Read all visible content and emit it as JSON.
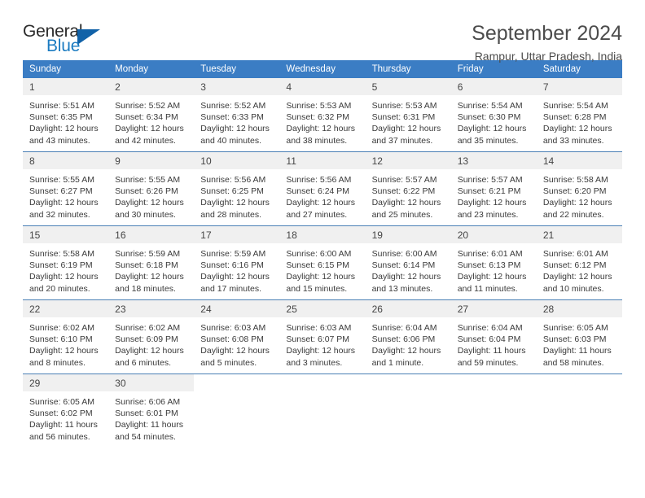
{
  "logo": {
    "word_top": "General",
    "word_bottom": "Blue",
    "triangle": "blue-triangle-icon"
  },
  "header": {
    "month_title": "September 2024",
    "location": "Rampur, Uttar Pradesh, India"
  },
  "colors": {
    "header_blue": "#3b7dc4",
    "logo_blue": "#1b7bc1",
    "daynum_bg": "#f0f0f0",
    "row_divider": "#4a7fb5"
  },
  "weekday_headers": [
    "Sunday",
    "Monday",
    "Tuesday",
    "Wednesday",
    "Thursday",
    "Friday",
    "Saturday"
  ],
  "weeks": [
    [
      {
        "day": "1",
        "sunrise": "Sunrise: 5:51 AM",
        "sunset": "Sunset: 6:35 PM",
        "daylight1": "Daylight: 12 hours",
        "daylight2": "and 43 minutes."
      },
      {
        "day": "2",
        "sunrise": "Sunrise: 5:52 AM",
        "sunset": "Sunset: 6:34 PM",
        "daylight1": "Daylight: 12 hours",
        "daylight2": "and 42 minutes."
      },
      {
        "day": "3",
        "sunrise": "Sunrise: 5:52 AM",
        "sunset": "Sunset: 6:33 PM",
        "daylight1": "Daylight: 12 hours",
        "daylight2": "and 40 minutes."
      },
      {
        "day": "4",
        "sunrise": "Sunrise: 5:53 AM",
        "sunset": "Sunset: 6:32 PM",
        "daylight1": "Daylight: 12 hours",
        "daylight2": "and 38 minutes."
      },
      {
        "day": "5",
        "sunrise": "Sunrise: 5:53 AM",
        "sunset": "Sunset: 6:31 PM",
        "daylight1": "Daylight: 12 hours",
        "daylight2": "and 37 minutes."
      },
      {
        "day": "6",
        "sunrise": "Sunrise: 5:54 AM",
        "sunset": "Sunset: 6:30 PM",
        "daylight1": "Daylight: 12 hours",
        "daylight2": "and 35 minutes."
      },
      {
        "day": "7",
        "sunrise": "Sunrise: 5:54 AM",
        "sunset": "Sunset: 6:28 PM",
        "daylight1": "Daylight: 12 hours",
        "daylight2": "and 33 minutes."
      }
    ],
    [
      {
        "day": "8",
        "sunrise": "Sunrise: 5:55 AM",
        "sunset": "Sunset: 6:27 PM",
        "daylight1": "Daylight: 12 hours",
        "daylight2": "and 32 minutes."
      },
      {
        "day": "9",
        "sunrise": "Sunrise: 5:55 AM",
        "sunset": "Sunset: 6:26 PM",
        "daylight1": "Daylight: 12 hours",
        "daylight2": "and 30 minutes."
      },
      {
        "day": "10",
        "sunrise": "Sunrise: 5:56 AM",
        "sunset": "Sunset: 6:25 PM",
        "daylight1": "Daylight: 12 hours",
        "daylight2": "and 28 minutes."
      },
      {
        "day": "11",
        "sunrise": "Sunrise: 5:56 AM",
        "sunset": "Sunset: 6:24 PM",
        "daylight1": "Daylight: 12 hours",
        "daylight2": "and 27 minutes."
      },
      {
        "day": "12",
        "sunrise": "Sunrise: 5:57 AM",
        "sunset": "Sunset: 6:22 PM",
        "daylight1": "Daylight: 12 hours",
        "daylight2": "and 25 minutes."
      },
      {
        "day": "13",
        "sunrise": "Sunrise: 5:57 AM",
        "sunset": "Sunset: 6:21 PM",
        "daylight1": "Daylight: 12 hours",
        "daylight2": "and 23 minutes."
      },
      {
        "day": "14",
        "sunrise": "Sunrise: 5:58 AM",
        "sunset": "Sunset: 6:20 PM",
        "daylight1": "Daylight: 12 hours",
        "daylight2": "and 22 minutes."
      }
    ],
    [
      {
        "day": "15",
        "sunrise": "Sunrise: 5:58 AM",
        "sunset": "Sunset: 6:19 PM",
        "daylight1": "Daylight: 12 hours",
        "daylight2": "and 20 minutes."
      },
      {
        "day": "16",
        "sunrise": "Sunrise: 5:59 AM",
        "sunset": "Sunset: 6:18 PM",
        "daylight1": "Daylight: 12 hours",
        "daylight2": "and 18 minutes."
      },
      {
        "day": "17",
        "sunrise": "Sunrise: 5:59 AM",
        "sunset": "Sunset: 6:16 PM",
        "daylight1": "Daylight: 12 hours",
        "daylight2": "and 17 minutes."
      },
      {
        "day": "18",
        "sunrise": "Sunrise: 6:00 AM",
        "sunset": "Sunset: 6:15 PM",
        "daylight1": "Daylight: 12 hours",
        "daylight2": "and 15 minutes."
      },
      {
        "day": "19",
        "sunrise": "Sunrise: 6:00 AM",
        "sunset": "Sunset: 6:14 PM",
        "daylight1": "Daylight: 12 hours",
        "daylight2": "and 13 minutes."
      },
      {
        "day": "20",
        "sunrise": "Sunrise: 6:01 AM",
        "sunset": "Sunset: 6:13 PM",
        "daylight1": "Daylight: 12 hours",
        "daylight2": "and 11 minutes."
      },
      {
        "day": "21",
        "sunrise": "Sunrise: 6:01 AM",
        "sunset": "Sunset: 6:12 PM",
        "daylight1": "Daylight: 12 hours",
        "daylight2": "and 10 minutes."
      }
    ],
    [
      {
        "day": "22",
        "sunrise": "Sunrise: 6:02 AM",
        "sunset": "Sunset: 6:10 PM",
        "daylight1": "Daylight: 12 hours",
        "daylight2": "and 8 minutes."
      },
      {
        "day": "23",
        "sunrise": "Sunrise: 6:02 AM",
        "sunset": "Sunset: 6:09 PM",
        "daylight1": "Daylight: 12 hours",
        "daylight2": "and 6 minutes."
      },
      {
        "day": "24",
        "sunrise": "Sunrise: 6:03 AM",
        "sunset": "Sunset: 6:08 PM",
        "daylight1": "Daylight: 12 hours",
        "daylight2": "and 5 minutes."
      },
      {
        "day": "25",
        "sunrise": "Sunrise: 6:03 AM",
        "sunset": "Sunset: 6:07 PM",
        "daylight1": "Daylight: 12 hours",
        "daylight2": "and 3 minutes."
      },
      {
        "day": "26",
        "sunrise": "Sunrise: 6:04 AM",
        "sunset": "Sunset: 6:06 PM",
        "daylight1": "Daylight: 12 hours",
        "daylight2": "and 1 minute."
      },
      {
        "day": "27",
        "sunrise": "Sunrise: 6:04 AM",
        "sunset": "Sunset: 6:04 PM",
        "daylight1": "Daylight: 11 hours",
        "daylight2": "and 59 minutes."
      },
      {
        "day": "28",
        "sunrise": "Sunrise: 6:05 AM",
        "sunset": "Sunset: 6:03 PM",
        "daylight1": "Daylight: 11 hours",
        "daylight2": "and 58 minutes."
      }
    ],
    [
      {
        "day": "29",
        "sunrise": "Sunrise: 6:05 AM",
        "sunset": "Sunset: 6:02 PM",
        "daylight1": "Daylight: 11 hours",
        "daylight2": "and 56 minutes."
      },
      {
        "day": "30",
        "sunrise": "Sunrise: 6:06 AM",
        "sunset": "Sunset: 6:01 PM",
        "daylight1": "Daylight: 11 hours",
        "daylight2": "and 54 minutes."
      },
      {
        "day": "",
        "sunrise": "",
        "sunset": "",
        "daylight1": "",
        "daylight2": ""
      },
      {
        "day": "",
        "sunrise": "",
        "sunset": "",
        "daylight1": "",
        "daylight2": ""
      },
      {
        "day": "",
        "sunrise": "",
        "sunset": "",
        "daylight1": "",
        "daylight2": ""
      },
      {
        "day": "",
        "sunrise": "",
        "sunset": "",
        "daylight1": "",
        "daylight2": ""
      },
      {
        "day": "",
        "sunrise": "",
        "sunset": "",
        "daylight1": "",
        "daylight2": ""
      }
    ]
  ]
}
